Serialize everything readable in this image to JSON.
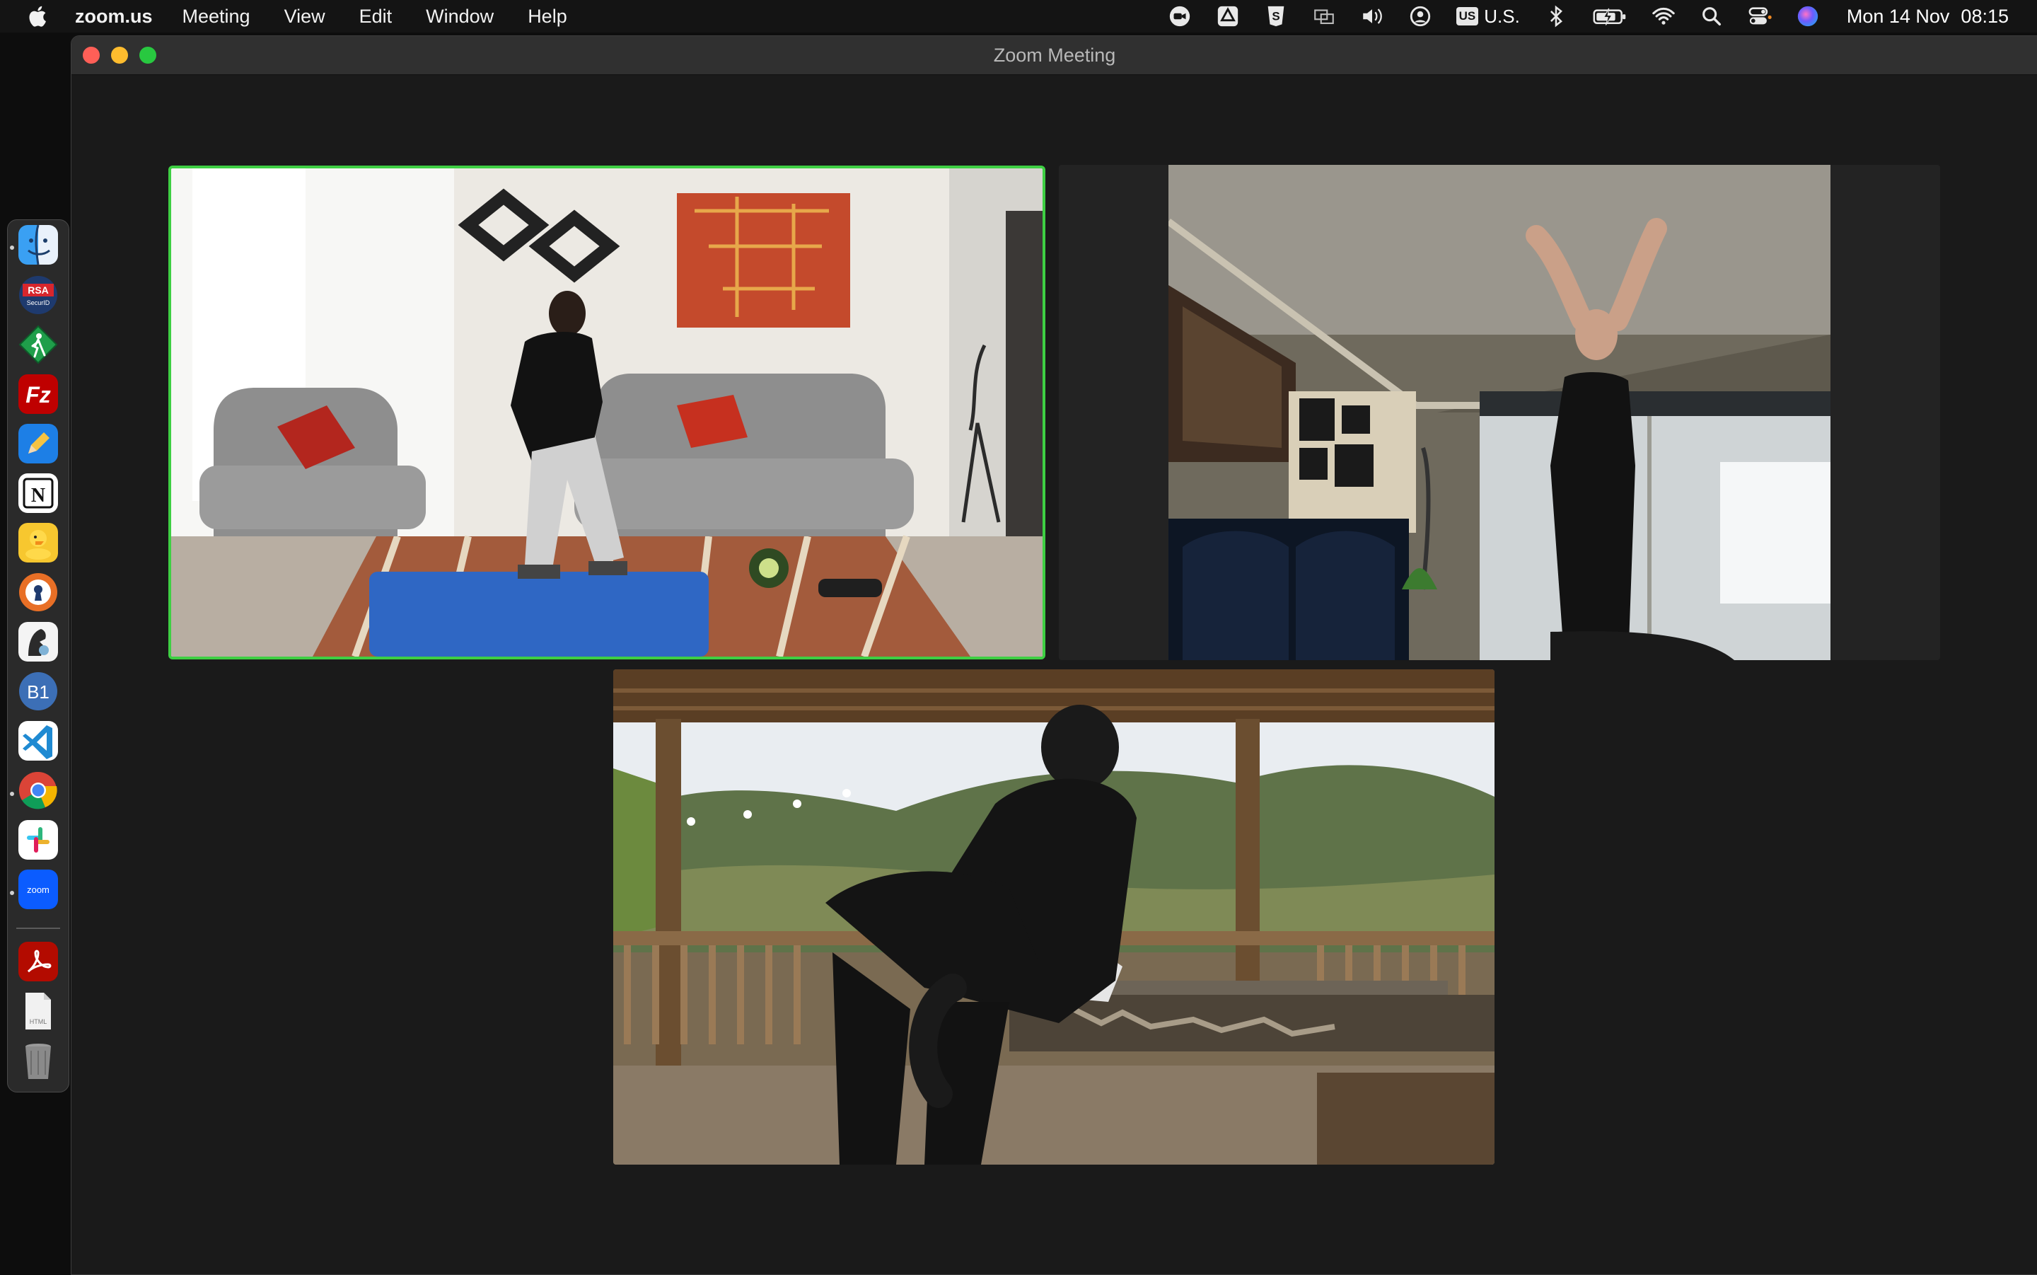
{
  "menubar": {
    "app_name": "zoom.us",
    "menus": [
      "Meeting",
      "View",
      "Edit",
      "Window",
      "Help"
    ],
    "status_icons": [
      "zoom-icon",
      "drive-icon",
      "s-app-icon",
      "display-icon",
      "volume-icon",
      "user-circle-icon",
      "keyboard-input-icon",
      "bluetooth-icon",
      "battery-icon",
      "wifi-icon",
      "search-icon",
      "control-center-icon",
      "siri-icon"
    ],
    "input_source_box": "US",
    "input_source": "U.S.",
    "date": "Mon 14 Nov",
    "time": "08:15"
  },
  "dock": {
    "apps": [
      {
        "name": "finder",
        "running": true
      },
      {
        "name": "rsa-securid",
        "label": "RSA",
        "sublabel": "SecurID"
      },
      {
        "name": "pedestrian-sign-app"
      },
      {
        "name": "filezilla",
        "label": "Fz"
      },
      {
        "name": "pencil-app"
      },
      {
        "name": "notion",
        "label": "N"
      },
      {
        "name": "cyberduck"
      },
      {
        "name": "keyhole-app"
      },
      {
        "name": "sequel-ace"
      },
      {
        "name": "b1-app",
        "label": "B1"
      },
      {
        "name": "vscode"
      },
      {
        "name": "chrome",
        "running": true
      },
      {
        "name": "slack"
      },
      {
        "name": "zoom",
        "label": "zoom",
        "running": true
      },
      {
        "name": "acrobat"
      },
      {
        "name": "html-file",
        "label": "HTML"
      },
      {
        "name": "trash"
      }
    ]
  },
  "window": {
    "title": "Zoom Meeting",
    "traffic_lights": {
      "close": "#ff5f57",
      "minimize": "#febc2e",
      "zoom": "#28c840"
    }
  },
  "participants": [
    {
      "tile": "participant-video-1",
      "scene": "living-room",
      "active_speaker": true
    },
    {
      "tile": "participant-video-2",
      "scene": "lounge"
    },
    {
      "tile": "participant-video-3",
      "scene": "porch"
    }
  ],
  "colors": {
    "active_speaker_border": "#3ecf43",
    "window_bg": "#1a1a1a"
  }
}
